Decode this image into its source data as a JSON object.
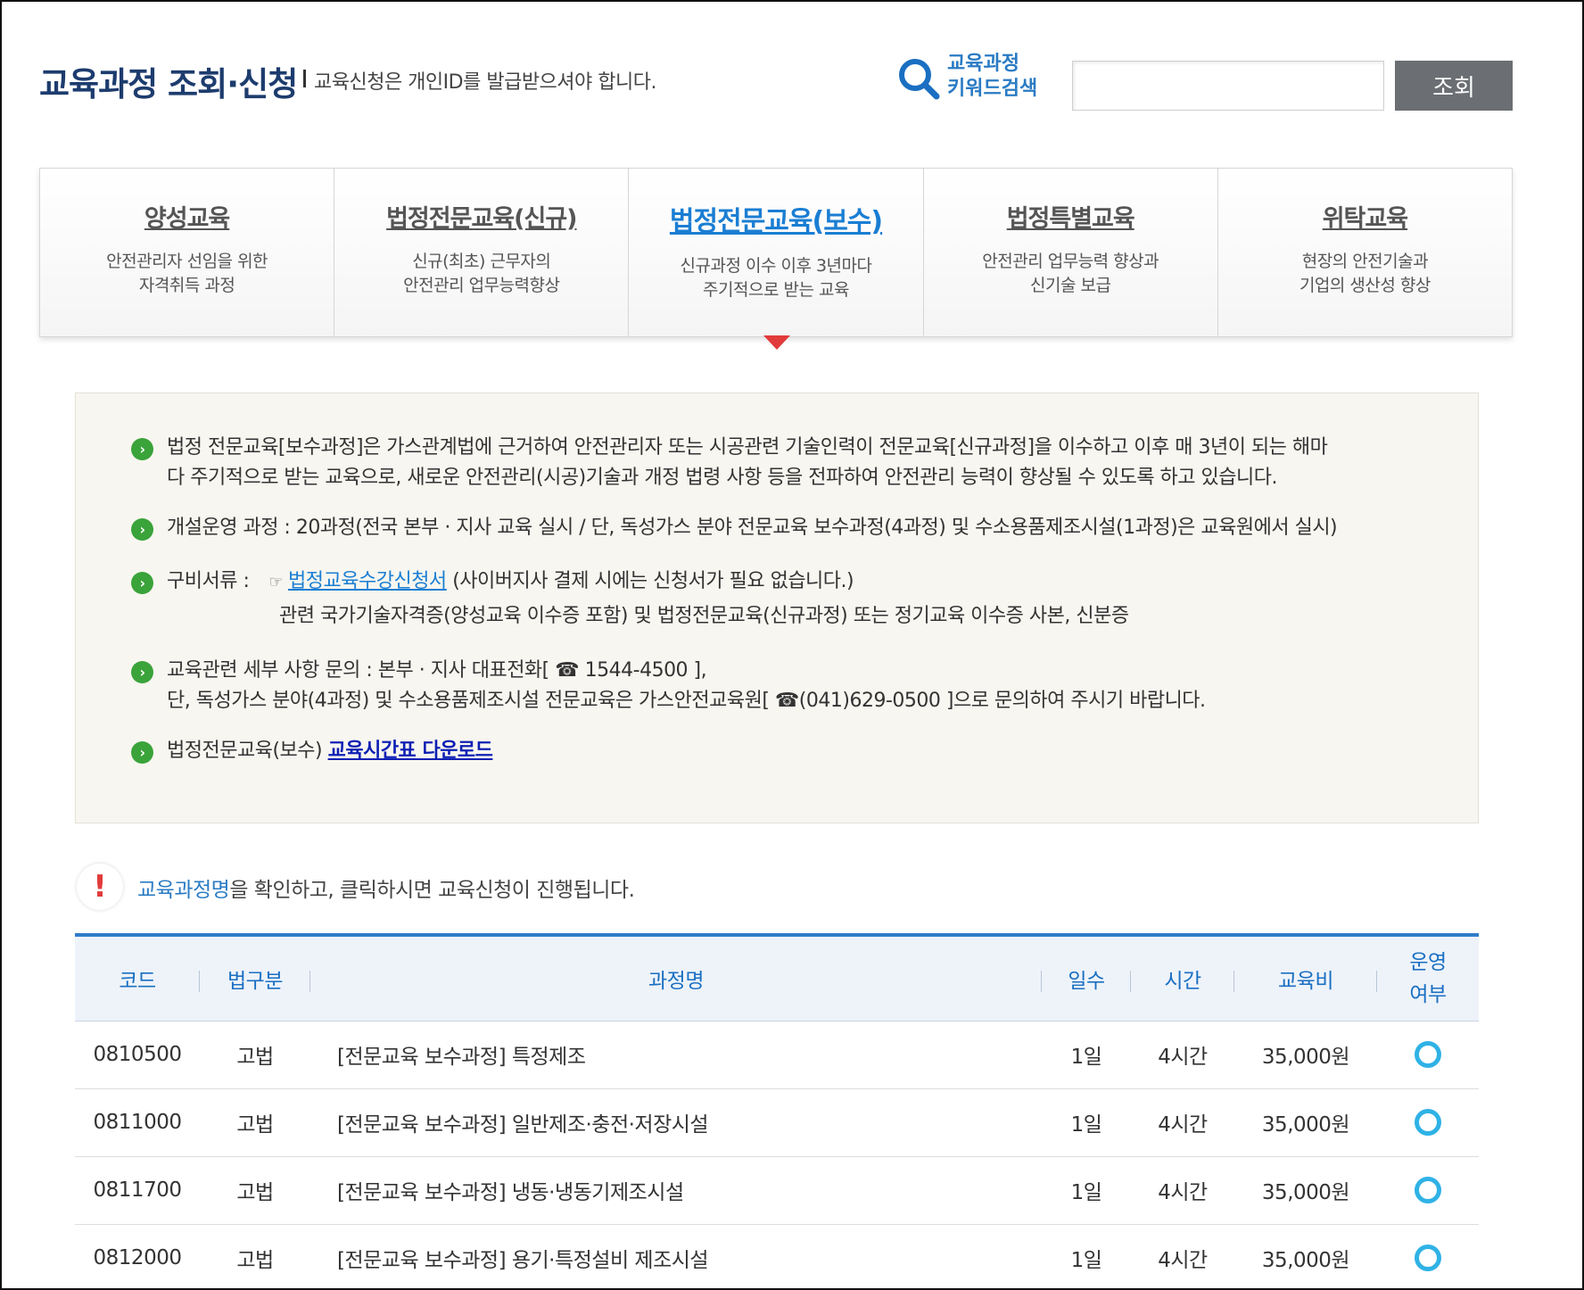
{
  "header": {
    "title": "교육과정 조회·신청",
    "subtitle": "교육신청은 개인ID를 발급받으셔야 합니다.",
    "search_label_line1": "교육과정",
    "search_label_line2": "키워드검색",
    "search_value": "",
    "search_button": "조회"
  },
  "tabs": [
    {
      "title": "양성교육",
      "desc1": "안전관리자 선임을 위한",
      "desc2": "자격취득 과정"
    },
    {
      "title": "법정전문교육(신규)",
      "desc1": "신규(최초) 근무자의",
      "desc2": "안전관리 업무능력향상"
    },
    {
      "title": "법정전문교육(보수)",
      "desc1": "신규과정 이수 이후 3년마다",
      "desc2": "주기적으로 받는 교육"
    },
    {
      "title": "법정특별교육",
      "desc1": "안전관리 업무능력 향상과",
      "desc2": "신기술 보급"
    },
    {
      "title": "위탁교육",
      "desc1": "현장의 안전기술과",
      "desc2": "기업의 생산성 향상"
    }
  ],
  "active_tab": 2,
  "info": {
    "item1_line1": "법정 전문교육[보수과정]은 가스관계법에 근거하여 안전관리자 또는 시공관련 기술인력이 전문교육[신규과정]을 이수하고 이후 매 3년이 되는 해마",
    "item1_line2": "다 주기적으로 받는 교육으로, 새로운 안전관리(시공)기술과 개정 법령 사항 등을 전파하여 안전관리 능력이 향상될 수 있도록 하고 있습니다.",
    "item2": "개설운영 과정 : 20과정(전국 본부 · 지사 교육 실시 / 단, 독성가스 분야 전문교육 보수과정(4과정) 및 수소용품제조시설(1과정)은 교육원에서 실시)",
    "item3_label": "구비서류 :",
    "item3_hand": "☞",
    "item3_link": "법정교육수강신청서",
    "item3_rest": "(사이버지사 결제 시에는 신청서가 필요 없습니다.)",
    "item3_line2": "관련 국가기술자격증(양성교육 이수증 포함) 및 법정전문교육(신규과정) 또는 정기교육 이수증 사본, 신분증",
    "item4_line1": "교육관련 세부 사항 문의 : 본부 · 지사 대표전화[ ☎ 1544-4500 ],",
    "item4_line2": "단, 독성가스 분야(4과정) 및 수소용품제조시설 전문교육은 가스안전교육원[ ☎(041)629-0500 ]으로 문의하여 주시기 바랍니다.",
    "item5_text": "법정전문교육(보수)",
    "item5_link": "교육시간표 다운로드"
  },
  "notice": {
    "highlight": "교육과정명",
    "text": "을 확인하고, 클릭하시면 교육신청이 진행됩니다.",
    "icon": "!"
  },
  "table": {
    "headers": {
      "code": "코드",
      "law": "법구분",
      "name": "과정명",
      "days": "일수",
      "hours": "시간",
      "fee": "교육비",
      "status_line1": "운영",
      "status_line2": "여부"
    },
    "rows": [
      {
        "code": "0810500",
        "law": "고법",
        "name": "[전문교육 보수과정] 특정제조",
        "days": "1일",
        "hours": "4시간",
        "fee": "35,000원",
        "status": "open-circle"
      },
      {
        "code": "0811000",
        "law": "고법",
        "name": "[전문교육 보수과정] 일반제조·충전·저장시설",
        "days": "1일",
        "hours": "4시간",
        "fee": "35,000원",
        "status": "open-circle"
      },
      {
        "code": "0811700",
        "law": "고법",
        "name": "[전문교육 보수과정] 냉동·냉동기제조시설",
        "days": "1일",
        "hours": "4시간",
        "fee": "35,000원",
        "status": "open-circle"
      },
      {
        "code": "0812000",
        "law": "고법",
        "name": "[전문교육 보수과정] 용기·특정설비 제조시설",
        "days": "1일",
        "hours": "4시간",
        "fee": "35,000원",
        "status": "open-circle"
      }
    ]
  },
  "colors": {
    "title": "#1d3c6e",
    "accent_blue": "#1a7ed3",
    "bullet_green": "#3aa33a",
    "arrow_red": "#e23b3b",
    "status_cyan": "#2fb2e6"
  }
}
